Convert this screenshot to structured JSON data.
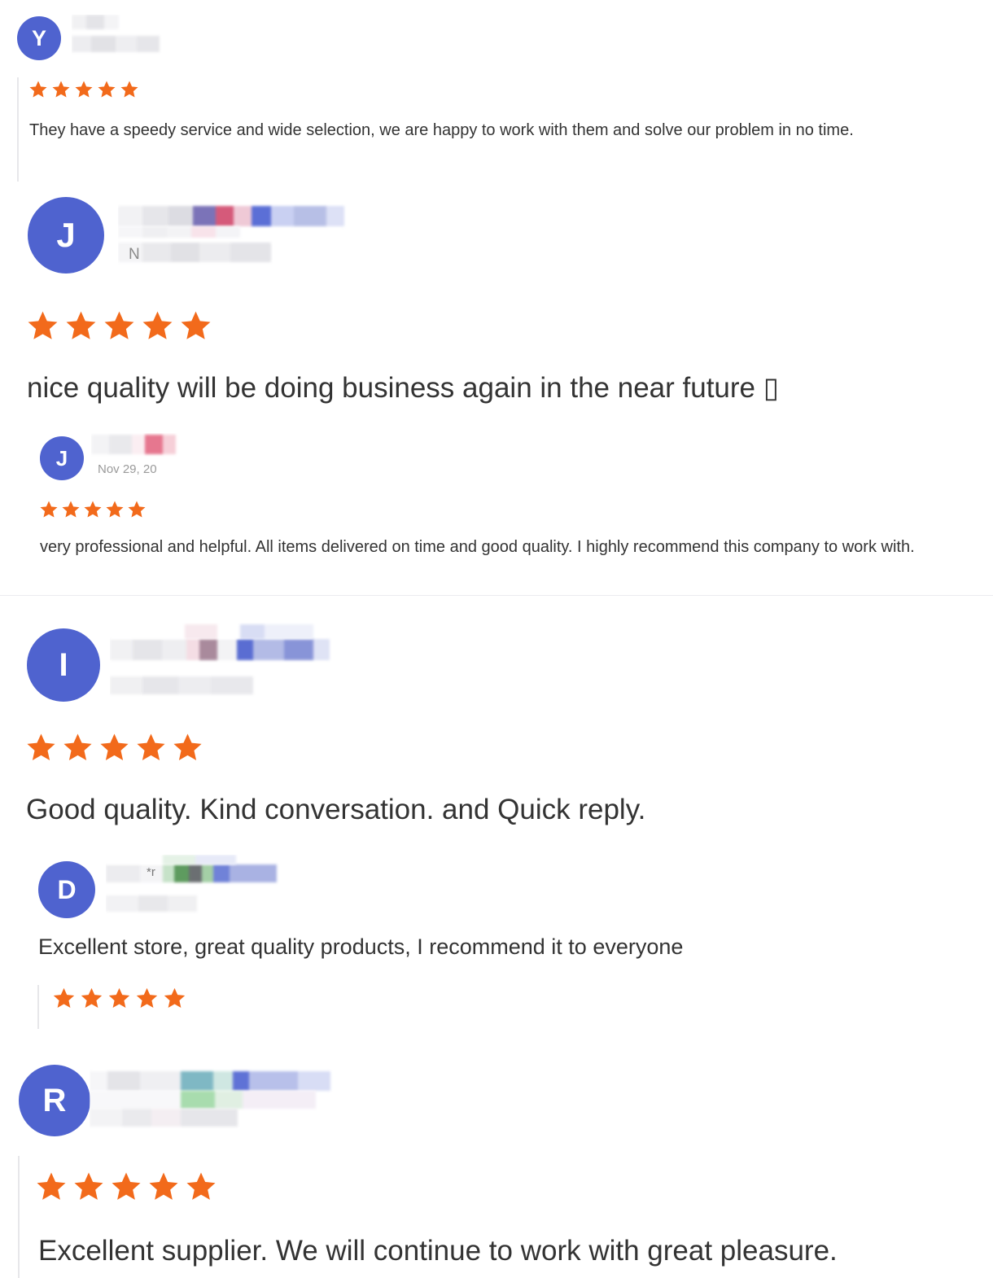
{
  "colors": {
    "avatar": "#4f63cf",
    "star": "#f26a1b",
    "text": "#333333"
  },
  "reviews": [
    {
      "avatar_letter": "Y",
      "rating": 5,
      "text": "They have a speedy service and wide selection, we are happy to work with them and solve our problem in no time."
    },
    {
      "avatar_letter": "J",
      "name_fragment": "N",
      "rating": 5,
      "text": "nice quality will be doing business again in the near future ▯"
    },
    {
      "avatar_letter": "J",
      "date": "Nov 29, 20",
      "rating": 5,
      "text": "very professional and helpful. All items delivered on time and good quality. I highly recommend this company to work with."
    },
    {
      "avatar_letter": "I",
      "rating": 5,
      "text": "Good quality. Kind conversation. and Quick reply."
    },
    {
      "avatar_letter": "D",
      "name_fragment": "*r",
      "rating": 5,
      "text": "Excellent store, great quality products, I recommend it to everyone"
    },
    {
      "avatar_letter": "R",
      "rating": 5,
      "text": "Excellent supplier. We will continue to work with great pleasure."
    }
  ]
}
